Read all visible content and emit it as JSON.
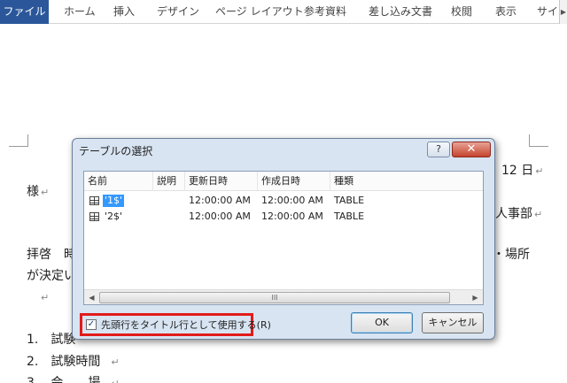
{
  "ribbon": {
    "tabs": [
      "ファイル",
      "ホーム",
      "挿入",
      "デザイン",
      "ページ レイアウト",
      "参考資料",
      "差し込み文書",
      "校閲",
      "表示",
      "サイ"
    ],
    "file_color": "#2b579a"
  },
  "document": {
    "lines": {
      "date_tail": "12 日",
      "sama": "様",
      "dept_tail": "人事部",
      "greeting": "拝啓　時",
      "place_tail": "・場所",
      "decided": "が決定い",
      "item1": "1.　試験",
      "item2": "2.　試験時間",
      "item3": "3.　会　　場"
    }
  },
  "dialog": {
    "title": "テーブルの選択",
    "help_label": "?",
    "close_label": "✕",
    "columns": [
      "名前",
      "説明",
      "更新日時",
      "作成日時",
      "種類"
    ],
    "rows": [
      {
        "name": "'1$'",
        "description": "",
        "modified": "12:00:00 AM",
        "created": "12:00:00 AM",
        "type": "TABLE",
        "selected": true
      },
      {
        "name": "'2$'",
        "description": "",
        "modified": "12:00:00 AM",
        "created": "12:00:00 AM",
        "type": "TABLE",
        "selected": false
      }
    ],
    "scroll_grip": "III",
    "checkbox_label": "先頭行をタイトル行として使用する(R)",
    "checkbox_checked": true,
    "ok_label": "OK",
    "cancel_label": "キャンセル",
    "highlight_color": "#e21b1b"
  }
}
